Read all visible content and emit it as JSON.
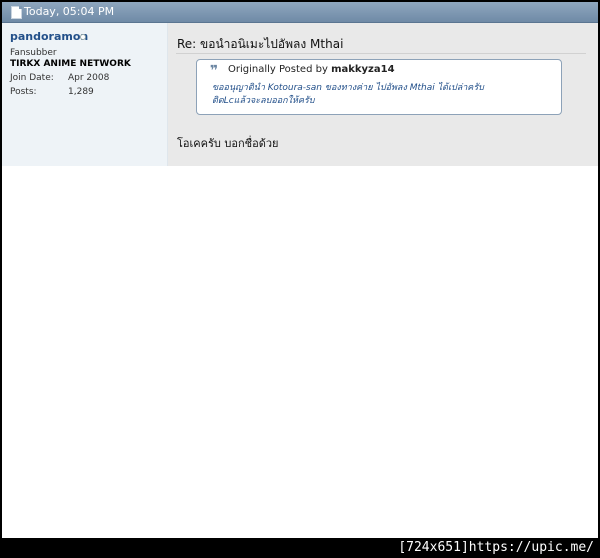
{
  "post": {
    "date": "Today, 05:04 PM",
    "title": "Re: ขอนำอนิเมะไปอัพลง Mthai",
    "message": "โอเคครับ บอกชื่อด้วย"
  },
  "user": {
    "name": "pandoramon",
    "title": "Fansubber",
    "group": "TIRKX ANIME NETWORK",
    "join_label": "Join Date:",
    "join_value": "Apr 2008",
    "posts_label": "Posts:",
    "posts_value": "1,289"
  },
  "quote": {
    "prefix": "Originally Posted by",
    "author": "makkyza14",
    "line1": "ขออนุญาตินำ Kotoura-san ของทางค่าย ไปอัพลง Mthai ได้เปล่าครับ",
    "line2": "ติดLcแล้วจะลบออกให้ครับ"
  },
  "footer": {
    "text": "[724x651]https://upic.me/"
  }
}
